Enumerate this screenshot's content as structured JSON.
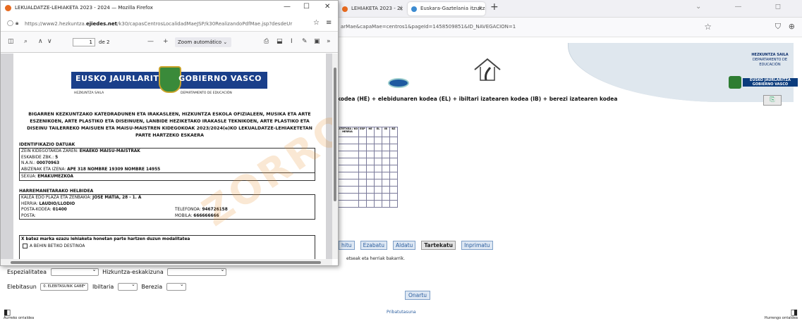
{
  "popup": {
    "title": "LEKUALDATZE-LEHIAKETA 2023 - 2024 — Mozilla Firefox",
    "controls": {
      "minimize": "—",
      "maximize": "☐",
      "close": "✕"
    },
    "url_prefix": "https://www2.hezkuntza.",
    "url_domain": "ejiedes.net",
    "url_rest": "/k30/capasCentrosLocalidadMaeJSP/k30RealizandoPdfMae.jsp?desdeUr",
    "pdf_toolbar": {
      "page_value": "1",
      "page_of": "de 2",
      "zoom_minus": "—",
      "zoom_plus": "+",
      "zoom_label": "Zoom automático",
      "overflow": "»"
    },
    "document": {
      "banner_left": "EUSKO JAURLARITZA",
      "banner_right": "GOBIERNO VASCO",
      "sub_left": "HEZKUNTZA SAILA",
      "sub_right": "DEPARTAMENTO DE EDUCACIÓN",
      "watermark": "ZORROA",
      "title": "BIGARREN KEZKUNTZAKO KATEDRADUNEN ETA IRAKASLEEN, HIZKUNTZA ESKOLA OFIZIALEEN, MUSIKA ETA ARTE ESZENIKOEN, ARTE PLASTIKO ETA DISEINUEN, LANBIDE HEZIKETAKO IRAKASLE TEKNIKOEN, ARTE PLASTIKO ETA DISEINU TAILERREKO MAISUEN ETA MAISU-MAISTREN KIDEGOKOAK 2023/2024(e)KO LEKUALDATZE-LEHIAKETETAN PARTE HARTZEKO ESKAERA",
      "sec1": "IDENTIFIKAZIO DATUAK",
      "kidegoa_label": "ZEIN KIDEGOTAKOA ZAREN: ",
      "kidegoa_value": "EHAEKO MAISU-MAISTRAK",
      "eskabide_label": "ESKABIDE ZBK.: ",
      "eskabide_value": "5",
      "nan_label": "N.A.N.: ",
      "nan_value": "00070963",
      "izena_label": "ABIZENAK ETA IZENA: ",
      "izena_value": "APE 318 NOMBRE 19309 NOMBRE 14955",
      "sexua_label": "SEXUA: ",
      "sexua_value": "EMAKUMEZKOA",
      "sec2": "HARREMANETARAKO HELBIDEA",
      "kalea_label": "KALEA EDO PLAZA ETA ZENBAKIA: ",
      "kalea_value": "JOSE MATIA, 28 - 1. A",
      "herria_label": "HERRIA: ",
      "herria_value": "LAUDIO/LLODIO",
      "posta_label": "POSTA-KODEA: ",
      "posta_value": "01400",
      "tel_label": "TELEFONOA: ",
      "tel_value": "946726158",
      "postal_label": "POSTA:",
      "mobila_label": "MOBILA: ",
      "mobila_value": "666666666",
      "mod_header": "X  batez marka ezazu lehiaketa honetan parte hartzen duzun modalitatea",
      "opt_a": "A   BEHIN BETIKO DESTINOA"
    }
  },
  "background": {
    "tab1_label": "LEHIAKETA 2023 - 2(",
    "tab2_label": "Euskara-Gaztelania itzultzaile a",
    "new_tab": "+",
    "url_text": "arMae&capaMae=centros1&pageId=1458509851&ID_NAVEGACION=1",
    "gv_line1": "HEZKUNTZA SAILA",
    "gv_line2": "DEPARTAMENTO DE EDUCACIÓN",
    "gv_badge": "EUSKO JAURLARITZA GOBIERNO VASCO",
    "formula": "kodea (HE) + elebidunaren kodea (EL) + ibiltari izatearen kodea (IB) + berezi izatearen kodea",
    "table_head": [
      "ASTETXEA / KO HERRIA",
      "ESP",
      "HE",
      "EL",
      "IB",
      "BZ"
    ],
    "buttons": [
      "hitu",
      "Ezabatu",
      "Aldatu",
      "Tartekatu",
      "Inprimatu"
    ],
    "note": "etseak eta herriak bakarrik.",
    "espezialitatea_label": "Espezialitatea",
    "hizkuntza_label": "Hizkuntza-eskakizuna",
    "elebitasun_label": "Elebitasun",
    "elebitasun_value": "0. ELEBITASUNIK GABE",
    "ibiltaria_label": "Ibiltaria",
    "berezia_label": "Berezia",
    "onartu": "Onartu",
    "pribatutasuna": "Pribatutasuna",
    "prev_page": "Aurreko orrialdea",
    "next_page": "Hurrengo orrialdea"
  }
}
